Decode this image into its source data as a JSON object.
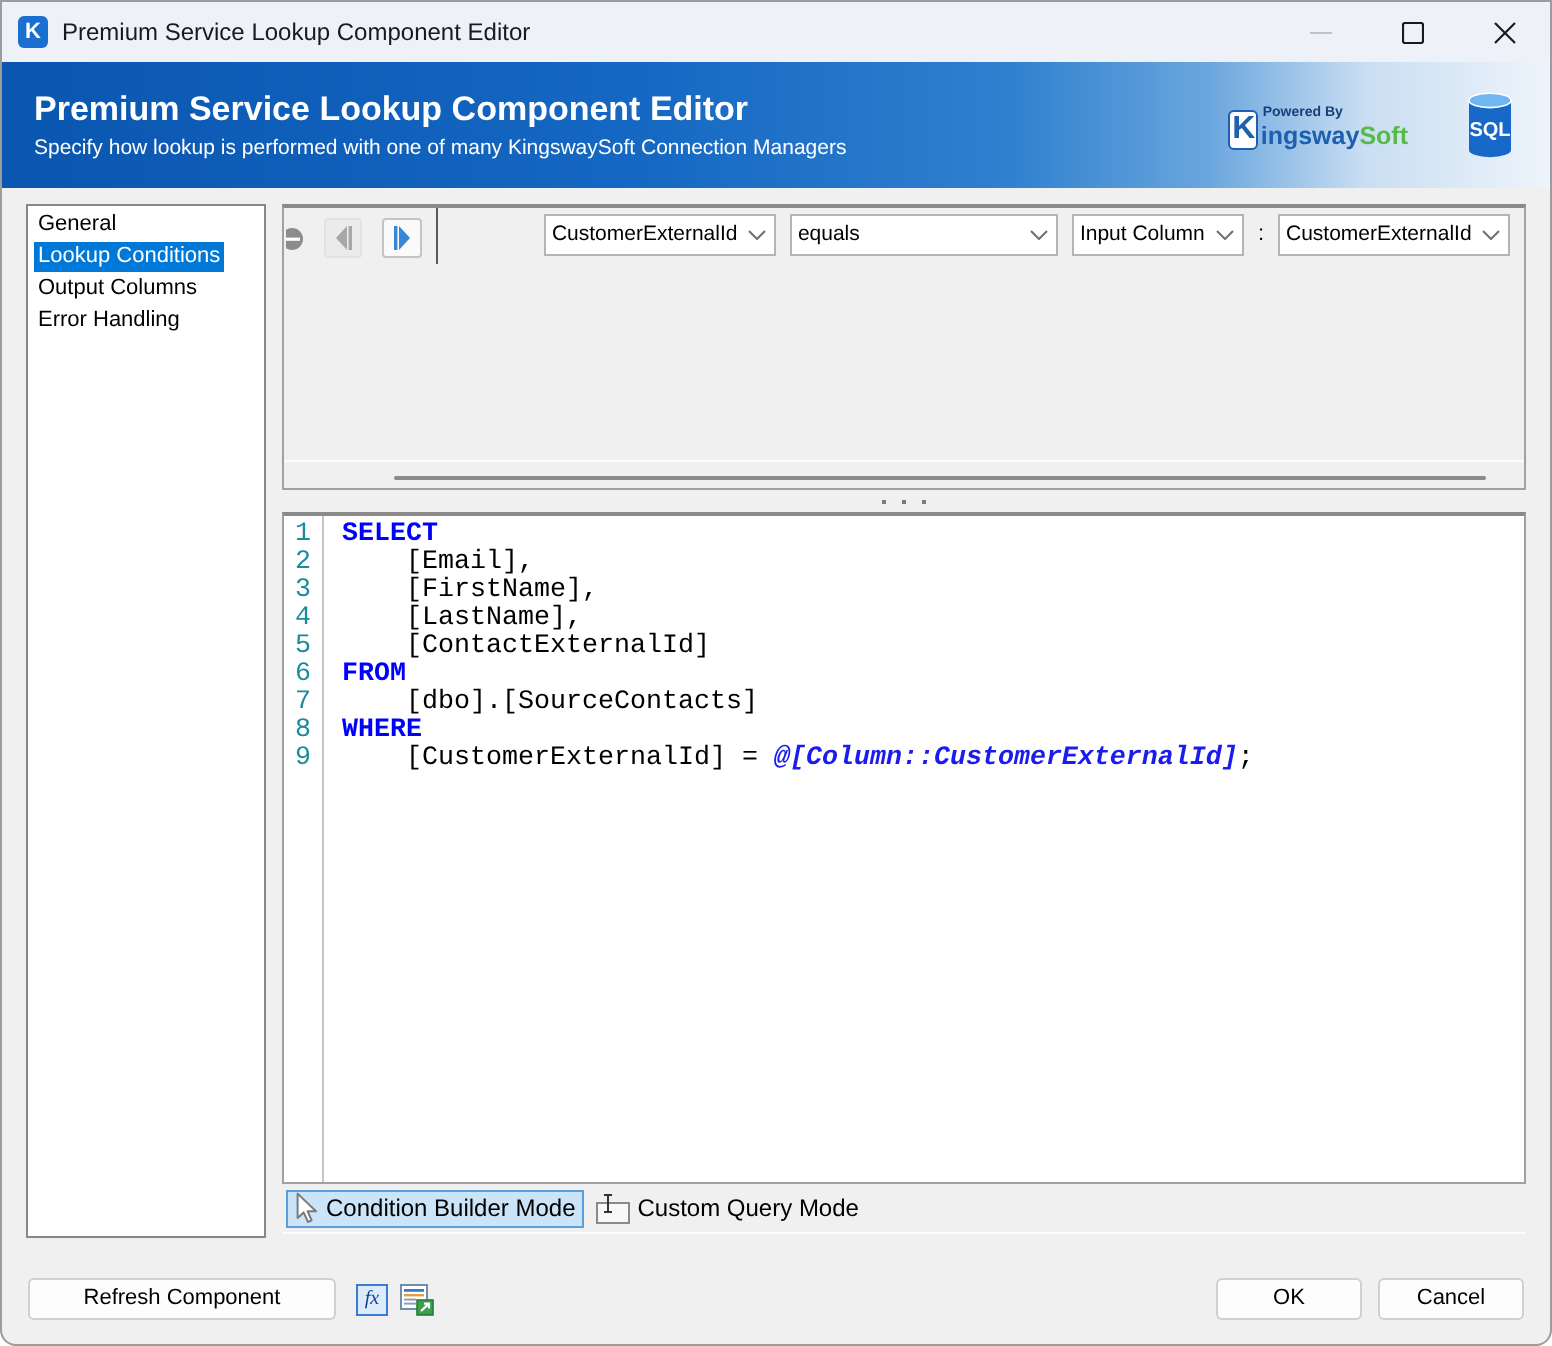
{
  "window": {
    "icon_letter": "K",
    "title": "Premium Service Lookup Component Editor",
    "controls": [
      {
        "kind": "minimize",
        "disabled": true
      },
      {
        "kind": "maximize",
        "disabled": false
      },
      {
        "kind": "close",
        "disabled": false
      }
    ]
  },
  "header": {
    "title": "Premium Service Lookup Component Editor",
    "subtitle": "Specify how lookup is performed with one of many KingswaySoft Connection Managers",
    "logo": {
      "tagline": "Powered By",
      "initial": "K",
      "name": "ingsway",
      "accent": "Soft"
    },
    "database_badge": "SQL"
  },
  "sidebar": {
    "items": [
      {
        "label": "General",
        "selected": false
      },
      {
        "label": "Lookup Conditions",
        "selected": true
      },
      {
        "label": "Output Columns",
        "selected": false
      },
      {
        "label": "Error Handling",
        "selected": false
      }
    ]
  },
  "condition_builder": {
    "toolbar": [
      {
        "kind": "remove",
        "disabled": true
      },
      {
        "kind": "previous",
        "disabled": true
      },
      {
        "kind": "next",
        "disabled": false
      }
    ],
    "condition": {
      "field": "CustomerExternalId",
      "operator": "equals",
      "source_type": "Input Column",
      "separator": ":",
      "value": "CustomerExternalId"
    }
  },
  "query_editor": {
    "clauses": [
      {
        "number": "1",
        "keyword": "SELECT",
        "children": [
          {
            "number": "2",
            "tokens": [
              {
                "kind": "text",
                "text": "[Email],"
              }
            ]
          },
          {
            "number": "3",
            "tokens": [
              {
                "kind": "text",
                "text": "[FirstName],"
              }
            ]
          },
          {
            "number": "4",
            "tokens": [
              {
                "kind": "text",
                "text": "[LastName],"
              }
            ]
          },
          {
            "number": "5",
            "tokens": [
              {
                "kind": "text",
                "text": "[ContactExternalId]"
              }
            ]
          }
        ]
      },
      {
        "number": "6",
        "keyword": "FROM",
        "children": [
          {
            "number": "7",
            "tokens": [
              {
                "kind": "text",
                "text": "[dbo].[SourceContacts]"
              }
            ]
          }
        ]
      },
      {
        "number": "8",
        "keyword": "WHERE",
        "children": [
          {
            "number": "9",
            "tokens": [
              {
                "kind": "text",
                "text": "[CustomerExternalId] = "
              },
              {
                "kind": "parameter",
                "text": "@[Column::CustomerExternalId]"
              },
              {
                "kind": "text",
                "text": ";"
              }
            ]
          }
        ]
      }
    ]
  },
  "modes": [
    {
      "kind": "builder",
      "label": "Condition Builder Mode",
      "selected": true
    },
    {
      "kind": "query",
      "label": "Custom Query Mode",
      "selected": false
    }
  ],
  "footer": {
    "refresh_button": "Refresh Component",
    "expression_button": "fx",
    "ok_button": "OK",
    "cancel_button": "Cancel"
  }
}
